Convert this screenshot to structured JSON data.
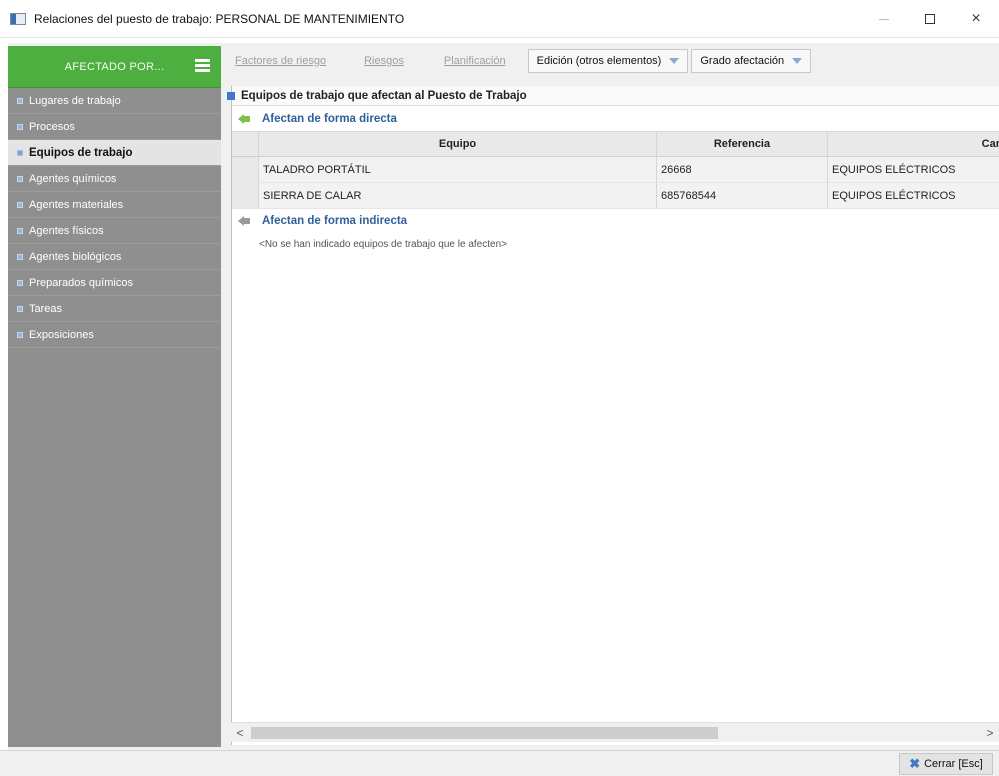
{
  "window": {
    "title": "Relaciones del puesto de trabajo: PERSONAL DE MANTENIMIENTO",
    "min_icon": "minimize-icon",
    "max_icon": "maximize-icon",
    "close_glyph": "×"
  },
  "sidebar": {
    "header": "AFECTADO POR...",
    "items": [
      {
        "label": "Lugares de trabajo"
      },
      {
        "label": "Procesos"
      },
      {
        "label": "Equipos de trabajo"
      },
      {
        "label": "Agentes químicos"
      },
      {
        "label": "Agentes materiales"
      },
      {
        "label": "Agentes físicos"
      },
      {
        "label": "Agentes biológicos"
      },
      {
        "label": "Preparados químicos"
      },
      {
        "label": "Tareas"
      },
      {
        "label": "Exposiciones"
      }
    ],
    "active_index": 2
  },
  "toolbar": {
    "factores": "Factores de riesgo",
    "riesgos": "Riesgos",
    "planificacion": "Planificación",
    "edicion": "Edición (otros elementos)",
    "grado": "Grado afectación"
  },
  "content": {
    "section_title": "Equipos de trabajo que afectan al Puesto de Trabajo",
    "direct_header": "Afectan de forma directa",
    "indirect_header": "Afectan de forma indirecta",
    "empty_note": "<No se han indicado equipos de trabajo que le afecten>",
    "table": {
      "headers": {
        "equipo": "Equipo",
        "referencia": "Referencia",
        "categoria": "Car"
      },
      "rows": [
        {
          "equipo": "TALADRO PORTÁTIL",
          "referencia": "26668",
          "categoria": "EQUIPOS ELÉCTRICOS"
        },
        {
          "equipo": "SIERRA DE CALAR",
          "referencia": "685768544",
          "categoria": "EQUIPOS ELÉCTRICOS"
        }
      ]
    }
  },
  "scrollbar": {
    "left": "<",
    "right": ">"
  },
  "footer": {
    "close_label": "Cerrar [Esc]"
  },
  "colors": {
    "accent_green": "#4caf3f",
    "sidebar_gray": "#8f8f8f",
    "link_blue": "#2f5f9a"
  }
}
